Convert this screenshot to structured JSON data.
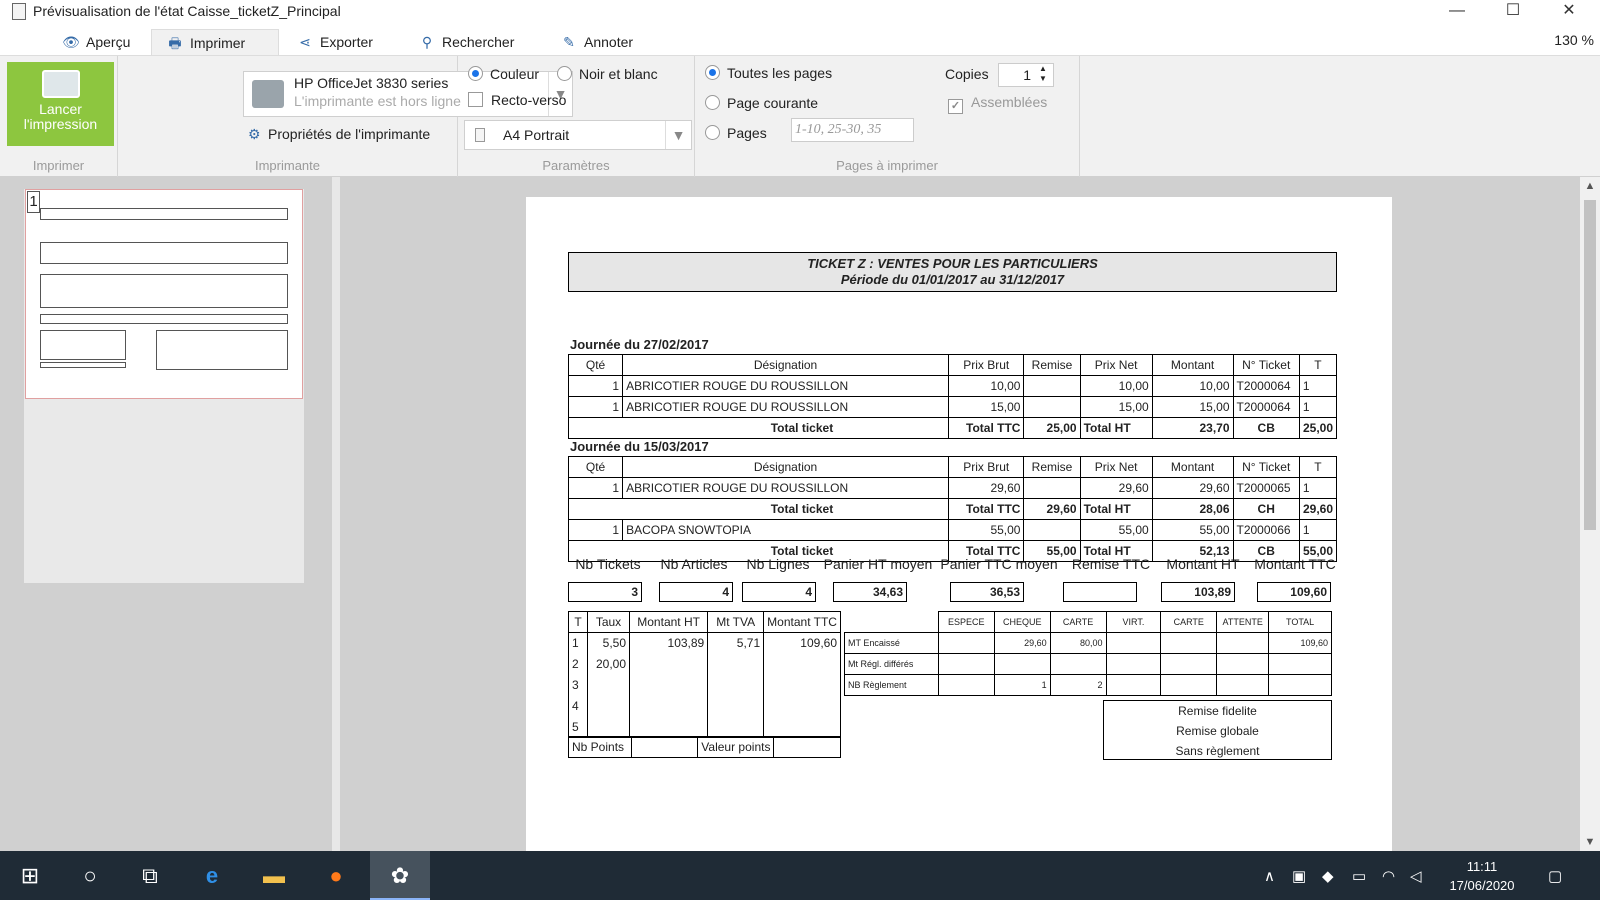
{
  "window": {
    "title": "Prévisualisation de l'état Caisse_ticketZ_Principal",
    "min": "—",
    "max": "☐",
    "close": "✕"
  },
  "tabs": [
    {
      "label": "Aperçu",
      "icon": "👁"
    },
    {
      "label": "Imprimer",
      "icon": "🖶"
    },
    {
      "label": "Exporter",
      "icon": "⋖"
    },
    {
      "label": "Rechercher",
      "icon": "⚲"
    },
    {
      "label": "Annoter",
      "icon": "✎"
    }
  ],
  "zoom": "130 %",
  "ribbon": {
    "launch_label": "Lancer l'impression",
    "printer_name": "HP OfficeJet 3830 series",
    "printer_status": "L'imprimante est hors ligne",
    "printer_props": "Propriétés de l'imprimante",
    "color": "Couleur",
    "bw": "Noir et blanc",
    "duplex": "Recto-verso",
    "paper": "A4 Portrait",
    "all_pages": "Toutes les pages",
    "current_page": "Page courante",
    "pages": "Pages",
    "pages_placeholder": "1-10, 25-30, 35",
    "copies_label": "Copies",
    "copies_value": "1",
    "collated": "Assemblées",
    "groups": [
      "Imprimer",
      "Imprimante",
      "Paramètres",
      "Pages à imprimer"
    ]
  },
  "thumb_page": "1",
  "doc": {
    "title": "TICKET Z : VENTES POUR LES PARTICULIERS",
    "period": "Période du 01/01/2017 au 31/12/2017",
    "headers": [
      "Qté",
      "Désignation",
      "Prix Brut",
      "Remise",
      "Prix Net",
      "Montant",
      "N° Ticket",
      "T"
    ],
    "days": [
      {
        "label": "Journée du 27/02/2017",
        "tickets": [
          {
            "rows": [
              [
                "1",
                "ABRICOTIER ROUGE DU ROUSSILLON",
                "10,00",
                "",
                "10,00",
                "10,00",
                "T2000064",
                "1"
              ],
              [
                "1",
                "ABRICOTIER ROUGE DU ROUSSILLON",
                "15,00",
                "",
                "15,00",
                "15,00",
                "T2000064",
                "1"
              ]
            ],
            "total": [
              "Total ticket",
              "Total TTC",
              "25,00",
              "Total HT",
              "23,70",
              "CB",
              "25,00"
            ]
          }
        ]
      },
      {
        "label": "Journée du 15/03/2017",
        "tickets": [
          {
            "rows": [
              [
                "1",
                "ABRICOTIER ROUGE DU ROUSSILLON",
                "29,60",
                "",
                "29,60",
                "29,60",
                "T2000065",
                "1"
              ]
            ],
            "total": [
              "Total ticket",
              "Total TTC",
              "29,60",
              "Total HT",
              "28,06",
              "CH",
              "29,60"
            ]
          },
          {
            "rows": [
              [
                "1",
                "BACOPA SNOWTOPIA",
                "55,00",
                "",
                "55,00",
                "55,00",
                "T2000066",
                "1"
              ]
            ],
            "total": [
              "Total ticket",
              "Total TTC",
              "55,00",
              "Total HT",
              "52,13",
              "CB",
              "55,00"
            ]
          }
        ]
      }
    ],
    "summary": {
      "labels": [
        "Nb Tickets",
        "Nb Articles",
        "Nb Lignes",
        "Panier HT moyen",
        "Panier TTC moyen",
        "Remise TTC",
        "Montant HT",
        "Montant TTC"
      ],
      "values": [
        "3",
        "4",
        "4",
        "34,63",
        "36,53",
        "",
        "103,89",
        "109,60"
      ]
    },
    "tva": {
      "headers": [
        "T",
        "Taux",
        "Montant HT",
        "Mt TVA",
        "Montant TTC"
      ],
      "rows": [
        [
          "1",
          "5,50",
          "103,89",
          "5,71",
          "109,60"
        ],
        [
          "2",
          "20,00",
          "",
          "",
          ""
        ],
        [
          "3",
          "",
          "",
          "",
          ""
        ],
        [
          "4",
          "",
          "",
          "",
          ""
        ],
        [
          "5",
          "",
          "",
          "",
          ""
        ]
      ]
    },
    "points": {
      "nb": "Nb Points",
      "val": "Valeur points"
    },
    "pay": {
      "headers": [
        "",
        "ESPECE",
        "CHEQUE",
        "CARTE",
        "VIRT.",
        "CARTE",
        "ATTENTE",
        "TOTAL"
      ],
      "rows": [
        [
          "MT Encaissé",
          "",
          "29,60",
          "80,00",
          "",
          "",
          "",
          "109,60"
        ],
        [
          "Mt Régl. différés",
          "",
          "",
          "",
          "",
          "",
          "",
          ""
        ],
        [
          "NB Règlement",
          "",
          "1",
          "2",
          "",
          "",
          "",
          ""
        ]
      ]
    },
    "remise": [
      "Remise fidelite",
      "Remise globale",
      "Sans règlement"
    ]
  },
  "taskbar": {
    "time": "11:11",
    "date": "17/06/2020"
  }
}
